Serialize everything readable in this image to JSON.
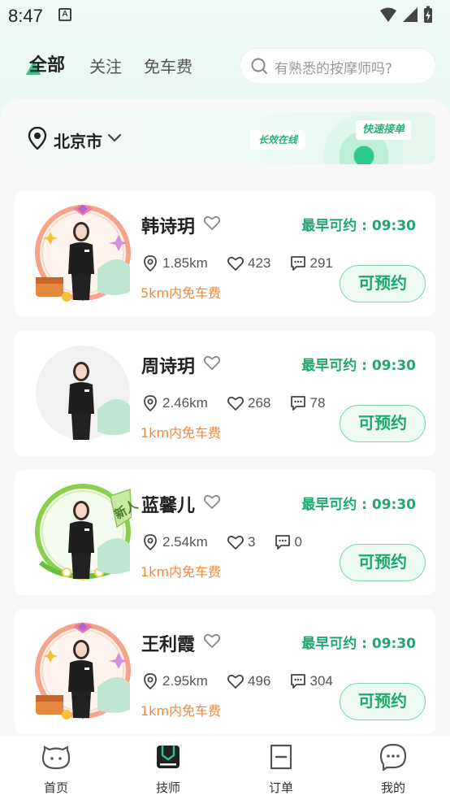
{
  "status": {
    "time": "8:47"
  },
  "tabs": [
    {
      "label": "全部",
      "active": true
    },
    {
      "label": "关注",
      "active": false
    },
    {
      "label": "免车费",
      "active": false
    }
  ],
  "search": {
    "placeholder": "有熟悉的按摩师吗?"
  },
  "location": {
    "city": "北京市",
    "promo_tag1": "长效在线",
    "promo_tag2": "快速接单"
  },
  "colors": {
    "accent": "#1fa86d",
    "orange": "#f0883a",
    "light_green": "#ecfaf3"
  },
  "therapists": [
    {
      "name": "韩诗玥",
      "earliest": "最早可约 : 09:30",
      "distance": "1.85km",
      "likes": "423",
      "comments": "291",
      "free_fee": "5km内免车费",
      "book": "可预约",
      "frame": "gold"
    },
    {
      "name": "周诗玥",
      "earliest": "最早可约 : 09:30",
      "distance": "2.46km",
      "likes": "268",
      "comments": "78",
      "free_fee": "1km内免车费",
      "book": "可预约",
      "frame": "plain"
    },
    {
      "name": "蓝馨儿",
      "earliest": "最早可约 : 09:30",
      "distance": "2.54km",
      "likes": "3",
      "comments": "0",
      "free_fee": "1km内免车费",
      "book": "可预约",
      "frame": "new",
      "badge": "新人"
    },
    {
      "name": "王利霞",
      "earliest": "最早可约 : 09:30",
      "distance": "2.95km",
      "likes": "496",
      "comments": "304",
      "free_fee": "1km内免车费",
      "book": "可预约",
      "frame": "gold"
    }
  ],
  "bottom_nav": [
    {
      "label": "首页",
      "icon": "home-face-icon"
    },
    {
      "label": "技师",
      "icon": "therapist-icon",
      "active": true
    },
    {
      "label": "订单",
      "icon": "order-icon"
    },
    {
      "label": "我的",
      "icon": "profile-icon"
    }
  ]
}
